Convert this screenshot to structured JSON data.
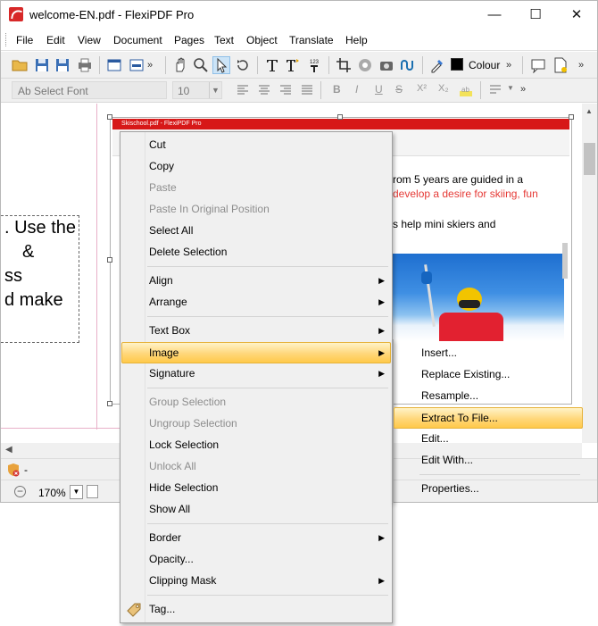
{
  "window": {
    "title": "welcome-EN.pdf - FlexiPDF Pro",
    "minimize": "—",
    "maximize": "☐",
    "close": "✕"
  },
  "menubar": [
    "File",
    "Edit",
    "View",
    "Document",
    "Pages",
    "Text",
    "Object",
    "Translate",
    "Help"
  ],
  "toolbar": {
    "colour_label": "Colour",
    "chevron": "»"
  },
  "format_bar": {
    "font_placeholder": "Select Font",
    "font_prefix": "Ab",
    "size": "10",
    "bold": "B",
    "italic": "I",
    "underline": "U",
    "strike": "S",
    "superscript": "X²",
    "subscript": "X₂",
    "chevron": "»"
  },
  "document": {
    "text_lines": [
      ". Use the",
      "&",
      "ss",
      "d make"
    ],
    "inner_title": "Skischool.pdf - FlexiPDF Pro",
    "inner_lines": [
      {
        "text": "rom 5 years are guided in a",
        "color": "#000000"
      },
      {
        "text": "develop a desire for skiing, fun",
        "color": "#e53935"
      },
      {
        "text": "s help mini skiers and",
        "color": "#000000"
      }
    ]
  },
  "status": {
    "indicator": "-",
    "zoom": "170%"
  },
  "context_menu": {
    "items": [
      {
        "label": "Cut",
        "disabled": false
      },
      {
        "label": "Copy",
        "disabled": false
      },
      {
        "label": "Paste",
        "disabled": true
      },
      {
        "label": "Paste In Original Position",
        "disabled": true
      },
      {
        "label": "Select All",
        "disabled": false
      },
      {
        "label": "Delete Selection",
        "disabled": false
      },
      {
        "label": "Align",
        "disabled": false,
        "submenu": true
      },
      {
        "label": "Arrange",
        "disabled": false,
        "submenu": true
      },
      {
        "label": "Text Box",
        "disabled": false,
        "submenu": true
      },
      {
        "label": "Image",
        "disabled": false,
        "submenu": true,
        "highlighted": true
      },
      {
        "label": "Signature",
        "disabled": false,
        "submenu": true
      },
      {
        "label": "Group Selection",
        "disabled": true
      },
      {
        "label": "Ungroup Selection",
        "disabled": true
      },
      {
        "label": "Lock Selection",
        "disabled": false
      },
      {
        "label": "Unlock All",
        "disabled": true
      },
      {
        "label": "Hide Selection",
        "disabled": false
      },
      {
        "label": "Show All",
        "disabled": false
      },
      {
        "label": "Border",
        "disabled": false,
        "submenu": true
      },
      {
        "label": "Opacity...",
        "disabled": false
      },
      {
        "label": "Clipping Mask",
        "disabled": false,
        "submenu": true
      },
      {
        "label": "Tag...",
        "disabled": false
      }
    ]
  },
  "image_submenu": {
    "items": [
      {
        "label": "Insert..."
      },
      {
        "label": "Replace Existing..."
      },
      {
        "label": "Resample..."
      },
      {
        "label": "Extract To File...",
        "highlighted": true
      },
      {
        "label": "Edit..."
      },
      {
        "label": "Edit With..."
      },
      {
        "label": "Properties..."
      }
    ]
  },
  "arrow_glyph": "▶"
}
